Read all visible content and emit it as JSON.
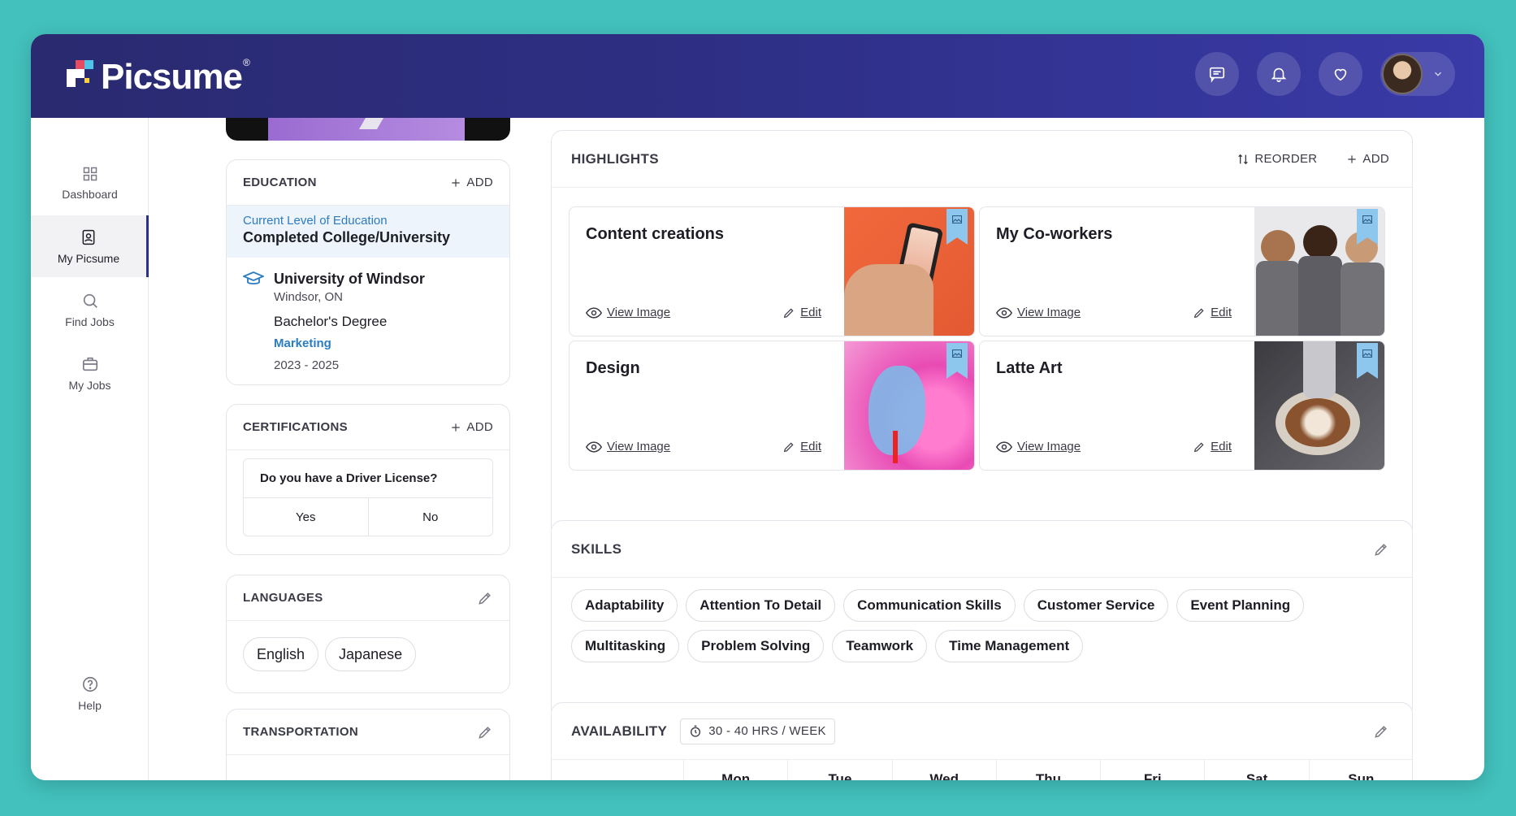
{
  "brand": {
    "name": "Picsume",
    "mark": "®"
  },
  "topbar": {
    "icons": [
      "chat-icon",
      "bell-icon",
      "heart-icon"
    ],
    "avatar": "user-avatar"
  },
  "sidebar": {
    "items": [
      {
        "label": "Dashboard",
        "icon": "grid-icon"
      },
      {
        "label": "My Picsume",
        "icon": "profile-icon",
        "active": true
      },
      {
        "label": "Find Jobs",
        "icon": "search-icon"
      },
      {
        "label": "My Jobs",
        "icon": "briefcase-icon"
      }
    ],
    "help": {
      "label": "Help",
      "icon": "help-icon"
    }
  },
  "education": {
    "title": "EDUCATION",
    "add": "ADD",
    "current_label": "Current Level of Education",
    "current_value": "Completed College/University",
    "school": "University of Windsor",
    "location": "Windsor, ON",
    "degree": "Bachelor's Degree",
    "field": "Marketing",
    "years": "2023 - 2025"
  },
  "certifications": {
    "title": "CERTIFICATIONS",
    "add": "ADD",
    "question": "Do you have a Driver License?",
    "yes": "Yes",
    "no": "No"
  },
  "languages": {
    "title": "LANGUAGES",
    "items": [
      "English",
      "Japanese"
    ]
  },
  "transportation": {
    "title": "TRANSPORTATION"
  },
  "highlights": {
    "title": "HIGHLIGHTS",
    "reorder": "REORDER",
    "add": "ADD",
    "view_label": "View Image",
    "edit_label": "Edit",
    "cards": [
      {
        "title": "Content creations"
      },
      {
        "title": "My Co-workers"
      },
      {
        "title": "Design"
      },
      {
        "title": "Latte Art"
      }
    ]
  },
  "skills": {
    "title": "SKILLS",
    "row1": [
      "Adaptability",
      "Attention To Detail",
      "Communication Skills",
      "Customer Service",
      "Event Planning"
    ],
    "row2": [
      "Multitasking",
      "Problem Solving",
      "Teamwork",
      "Time Management"
    ]
  },
  "availability": {
    "title": "AVAILABILITY",
    "hours": "30 - 40 HRS / WEEK",
    "days": [
      "Mon",
      "Tue",
      "Wed",
      "Thu",
      "Fri",
      "Sat",
      "Sun"
    ]
  },
  "colors": {
    "topbar": "#2e2f86",
    "accent_blue": "#2b7cc1",
    "background": "#43c1bd"
  }
}
